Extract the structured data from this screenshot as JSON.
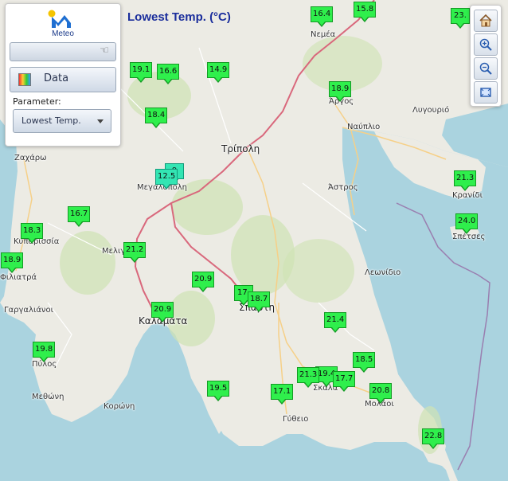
{
  "map_title": "Lowest Temp. (°C)",
  "logo_text": "Meteo",
  "panel": {
    "data_button_label": "Data",
    "parameter_label": "Parameter:",
    "parameter_value": "Lowest Temp."
  },
  "toolbar": {
    "icons": [
      "home-icon",
      "zoom-in-icon",
      "zoom-out-icon",
      "fit-extent-icon"
    ]
  },
  "places": [
    {
      "name": "Τρίπολη",
      "key": "tripoli"
    },
    {
      "name": "Άργος",
      "key": "argos"
    },
    {
      "name": "Ναύπλιο",
      "key": "nafplio"
    },
    {
      "name": "Λυγουριό",
      "key": "lygourio"
    },
    {
      "name": "Νεμέα",
      "key": "nemea"
    },
    {
      "name": "Άστρος",
      "key": "astros"
    },
    {
      "name": "Κρανίδι",
      "key": "kranidi"
    },
    {
      "name": "Σπέτσες",
      "key": "spetses"
    },
    {
      "name": "Μεγαλόπολη",
      "key": "megalopoli"
    },
    {
      "name": "Ζαχάρω",
      "key": "zacharo"
    },
    {
      "name": "Κυπαρισσία",
      "key": "kyparissia"
    },
    {
      "name": "Μελιγαλάς",
      "key": "meligalas"
    },
    {
      "name": "Φιλιατρά",
      "key": "filiatra"
    },
    {
      "name": "Γαργαλιάνοι",
      "key": "gargaliani"
    },
    {
      "name": "Καλαμάτα",
      "key": "kalamata"
    },
    {
      "name": "Σπάρτη",
      "key": "sparti"
    },
    {
      "name": "Λεωνίδιο",
      "key": "leonidio"
    },
    {
      "name": "Πύλος",
      "key": "pylos"
    },
    {
      "name": "Μεθώνη",
      "key": "methoni"
    },
    {
      "name": "Κορώνη",
      "key": "koroni"
    },
    {
      "name": "Γύθειο",
      "key": "gytheio"
    },
    {
      "name": "Σκάλα",
      "key": "skala"
    },
    {
      "name": "Μολάοι",
      "key": "molaoi"
    }
  ],
  "stations": [
    {
      "key": "nemea",
      "value": "16.4"
    },
    {
      "key": "corinth-south",
      "value": "15.8"
    },
    {
      "key": "loutraki",
      "value": "23."
    },
    {
      "key": "kalavryta",
      "value": "19.1"
    },
    {
      "key": "tropaia",
      "value": "16.6"
    },
    {
      "key": "levidi",
      "value": "14.9"
    },
    {
      "key": "argos",
      "value": "18.9"
    },
    {
      "key": "andritsaina",
      "value": "18.4"
    },
    {
      "key": "megalopoli-a",
      "value": "12.5"
    },
    {
      "key": "megalopoli-b",
      "value": "9"
    },
    {
      "key": "kranidi",
      "value": "21.3"
    },
    {
      "key": "spetses",
      "value": "24.0"
    },
    {
      "key": "kyparissia",
      "value": "18.3"
    },
    {
      "key": "figaleia",
      "value": "16.7"
    },
    {
      "key": "filiatra",
      "value": "18.9"
    },
    {
      "key": "meligalas",
      "value": "21.2"
    },
    {
      "key": "taygetos",
      "value": "20.9"
    },
    {
      "key": "sparti-a",
      "value": "17."
    },
    {
      "key": "sparti-b",
      "value": "18.7"
    },
    {
      "key": "kalamata",
      "value": "20.9"
    },
    {
      "key": "geraki",
      "value": "21.4"
    },
    {
      "key": "pylos",
      "value": "19.8"
    },
    {
      "key": "molaoi-n",
      "value": "18.5"
    },
    {
      "key": "skala-a",
      "value": "21.3"
    },
    {
      "key": "skala-b",
      "value": "19.4"
    },
    {
      "key": "skala-c",
      "value": "17.7"
    },
    {
      "key": "molaoi",
      "value": "20.8"
    },
    {
      "key": "areopoli",
      "value": "19.5"
    },
    {
      "key": "gytheio",
      "value": "17.1"
    },
    {
      "key": "neapoli",
      "value": "22.8"
    }
  ],
  "colors": {
    "marker_green": "#2fef4c",
    "marker_cyan": "#33e5b3",
    "title_blue": "#1b2e9c",
    "sea": "#aad3df",
    "land": "#ecebe4"
  }
}
